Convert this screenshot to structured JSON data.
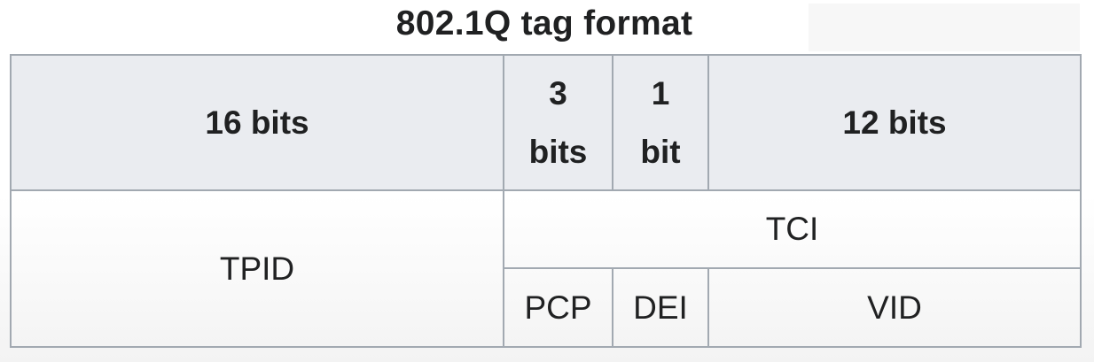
{
  "title": "802.1Q tag format",
  "header": {
    "tpid_size": "16 bits",
    "pcp_size_num": "3",
    "pcp_size_unit": "bits",
    "dei_size_num": "1",
    "dei_size_unit": "bit",
    "vid_size": "12 bits"
  },
  "fields": {
    "tpid": "TPID",
    "tci": "TCI",
    "pcp": "PCP",
    "dei": "DEI",
    "vid": "VID"
  }
}
